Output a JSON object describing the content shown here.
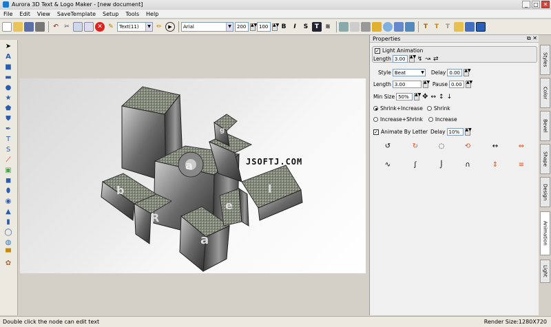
{
  "window": {
    "title": "Aurora 3D Text & Logo Maker - [new document]",
    "min": "_",
    "max": "□",
    "close": "✕"
  },
  "menu": [
    "File",
    "Edit",
    "View",
    "SaveTemplate",
    "Setup",
    "Tools",
    "Help"
  ],
  "toolbar": {
    "text_combo": "Text(11)",
    "font_combo": "Arial",
    "size1": "200",
    "size2": "100",
    "bold": "B",
    "italic": "I",
    "strike": "S",
    "textstyle": "T"
  },
  "canvas": {
    "watermark": "JSOFTJ.COM"
  },
  "panel": {
    "title": "Properties",
    "light_animation_label": "Light Animation",
    "length_label": "Length",
    "length_value": "3.00",
    "style_label": "Style",
    "style_value": "Beat",
    "delay_label": "Delay",
    "delay_value": "0.00",
    "length2_label": "Length",
    "length2_value": "3.00",
    "pause_label": "Pause",
    "pause_value": "0.00",
    "minsize_label": "Min Size",
    "minsize_value": "50%",
    "shrink_increase": "Shrink+Increase",
    "shrink": "Shrink",
    "increase_shrink": "Increase+Shrink",
    "increase": "Increase",
    "animate_by_letter": "Animate By Letter",
    "delay2_label": "Delay",
    "delay2_value": "10%"
  },
  "side_tabs": [
    "Styles",
    "Color",
    "Bevel",
    "Shape",
    "Design",
    "Animation",
    "Light"
  ],
  "status": {
    "hint": "Double click the node can edit text",
    "render": "Render Size:1280X720"
  }
}
